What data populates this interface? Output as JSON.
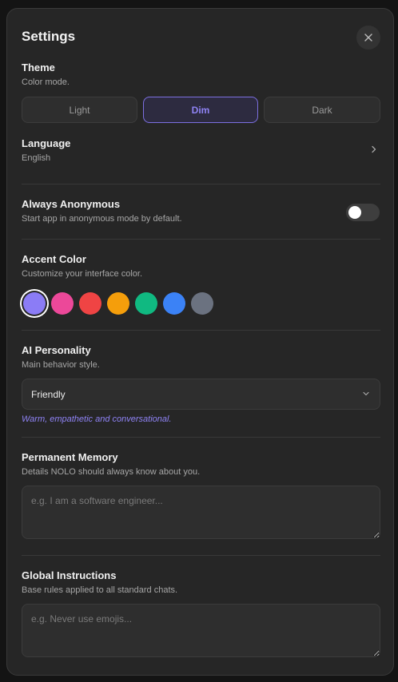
{
  "header": {
    "title": "Settings",
    "close_icon": "close-icon"
  },
  "theme": {
    "title": "Theme",
    "subtitle": "Color mode.",
    "options": [
      {
        "label": "Light",
        "selected": false
      },
      {
        "label": "Dim",
        "selected": true
      },
      {
        "label": "Dark",
        "selected": false
      }
    ]
  },
  "language": {
    "title": "Language",
    "value": "English",
    "icon": "chevron-right-icon"
  },
  "anonymous": {
    "title": "Always Anonymous",
    "subtitle": "Start app in anonymous mode by default.",
    "enabled": false
  },
  "accent": {
    "title": "Accent Color",
    "subtitle": "Customize your interface color.",
    "colors": [
      "#8b7cf6",
      "#ec4899",
      "#ef4444",
      "#f59e0b",
      "#10b981",
      "#3b82f6",
      "#6b7280"
    ],
    "selected_index": 0
  },
  "personality": {
    "title": "AI Personality",
    "subtitle": "Main behavior style.",
    "selected": "Friendly",
    "description": "Warm, empathetic and conversational.",
    "icon": "chevron-down-icon"
  },
  "memory": {
    "title": "Permanent Memory",
    "subtitle": "Details NOLO should always know about you.",
    "placeholder": "e.g. I am a software engineer...",
    "value": ""
  },
  "instructions": {
    "title": "Global Instructions",
    "subtitle": "Base rules applied to all standard chats.",
    "placeholder": "e.g. Never use emojis...",
    "value": ""
  },
  "colors": {
    "background": "#262626",
    "accent": "#8f83f5"
  }
}
